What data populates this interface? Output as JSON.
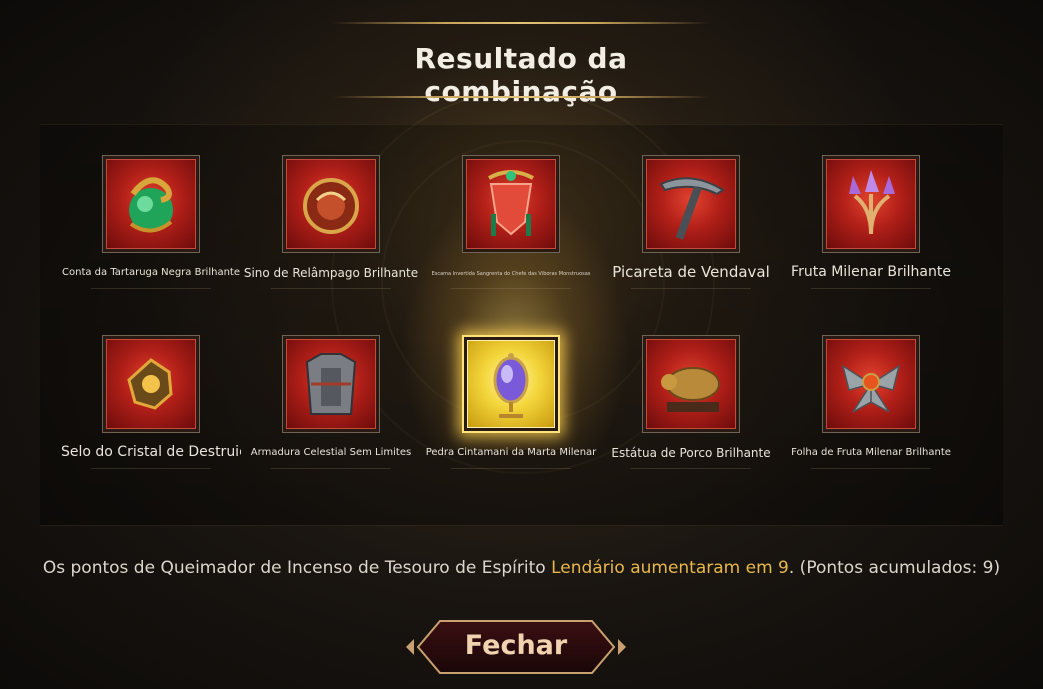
{
  "title": "Resultado da combinação",
  "items": [
    {
      "name": "Conta da Tartaruga Negra Brilhante",
      "icon": "green-orb-turtle-icon"
    },
    {
      "name": "Sino de Relâmpago Brilhante",
      "icon": "lightning-bell-icon"
    },
    {
      "name": "Escama Invertida Sangrenta do Chefe das Víboras Monstruosas",
      "icon": "red-scale-amulet-icon"
    },
    {
      "name": "Picareta de Vendaval",
      "icon": "pickaxe-icon"
    },
    {
      "name": "Fruta Milenar Brilhante",
      "icon": "crystal-fruit-icon"
    },
    {
      "name": "Selo do Cristal de Destruição",
      "icon": "crystal-seal-icon"
    },
    {
      "name": "Armadura Celestial Sem Limites",
      "icon": "armor-icon"
    },
    {
      "name": "Pedra Cintamani da Marta Milenar",
      "icon": "cintamani-stone-icon",
      "rarity": "legendary"
    },
    {
      "name": "Estátua de Porco Brilhante",
      "icon": "pig-statue-icon"
    },
    {
      "name": "Folha de Fruta Milenar Brilhante",
      "icon": "fruit-leaf-icon"
    }
  ],
  "message": {
    "prefix": "Os pontos de Queimador de Incenso de Tesouro de Espírito ",
    "highlight": "Lendário aumentaram em 9",
    "suffix": ". (Pontos acumulados: 9)"
  },
  "close_label": "Fechar",
  "colors": {
    "highlight": "#e8b84a",
    "accent_gold": "#c9a45c",
    "legendary_gold": "#ffe27a"
  }
}
